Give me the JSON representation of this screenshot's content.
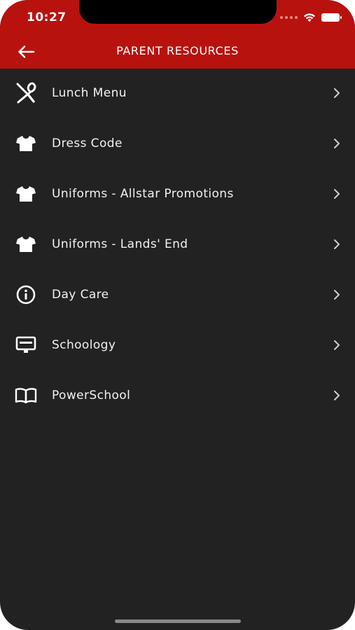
{
  "status_bar": {
    "time": "10:27"
  },
  "header": {
    "title": "PARENT RESOURCES",
    "back_icon": "arrow-left-icon"
  },
  "colors": {
    "header_bg": "#b8120f",
    "body_bg": "#222222",
    "text": "#f2f2f2"
  },
  "menu": {
    "items": [
      {
        "label": "Lunch Menu",
        "icon": "utensils-icon"
      },
      {
        "label": "Dress Code",
        "icon": "tshirt-icon"
      },
      {
        "label": "Uniforms - Allstar Promotions",
        "icon": "tshirt-icon"
      },
      {
        "label": "Uniforms - Lands' End",
        "icon": "tshirt-icon"
      },
      {
        "label": "Day Care",
        "icon": "info-circle-icon"
      },
      {
        "label": "Schoology",
        "icon": "monitor-icon"
      },
      {
        "label": "PowerSchool",
        "icon": "open-book-icon"
      }
    ]
  }
}
